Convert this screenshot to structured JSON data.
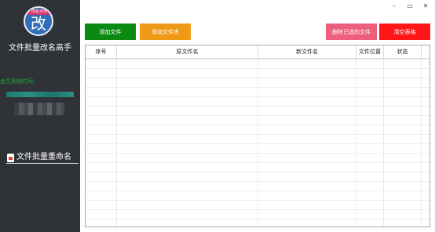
{
  "sidebar": {
    "logo_badge": "改名大师",
    "logo_char": "改",
    "app_title": "文件批量改名高手",
    "member_expire_label": "会员到期时间:",
    "menu_item_label": "文件批量重命名"
  },
  "titlebar": {
    "minimize": "–",
    "maximize": "▭",
    "close": "✕"
  },
  "toolbar": {
    "add_file": "添加文件",
    "add_folder": "添加文件夹",
    "delete_selected": "删除已选的文件",
    "clear_table": "清空表格"
  },
  "table": {
    "columns": [
      "序号",
      "原文件名",
      "新文件名",
      "文件位置",
      "状态"
    ],
    "rows": []
  },
  "colors": {
    "sidebar_bg": "#2f3237",
    "add_file": "#0a8a12",
    "add_folder": "#ef9a16",
    "delete_selected": "#ee5f7d",
    "clear_table": "#ff1717",
    "member_text": "#22a83a"
  }
}
